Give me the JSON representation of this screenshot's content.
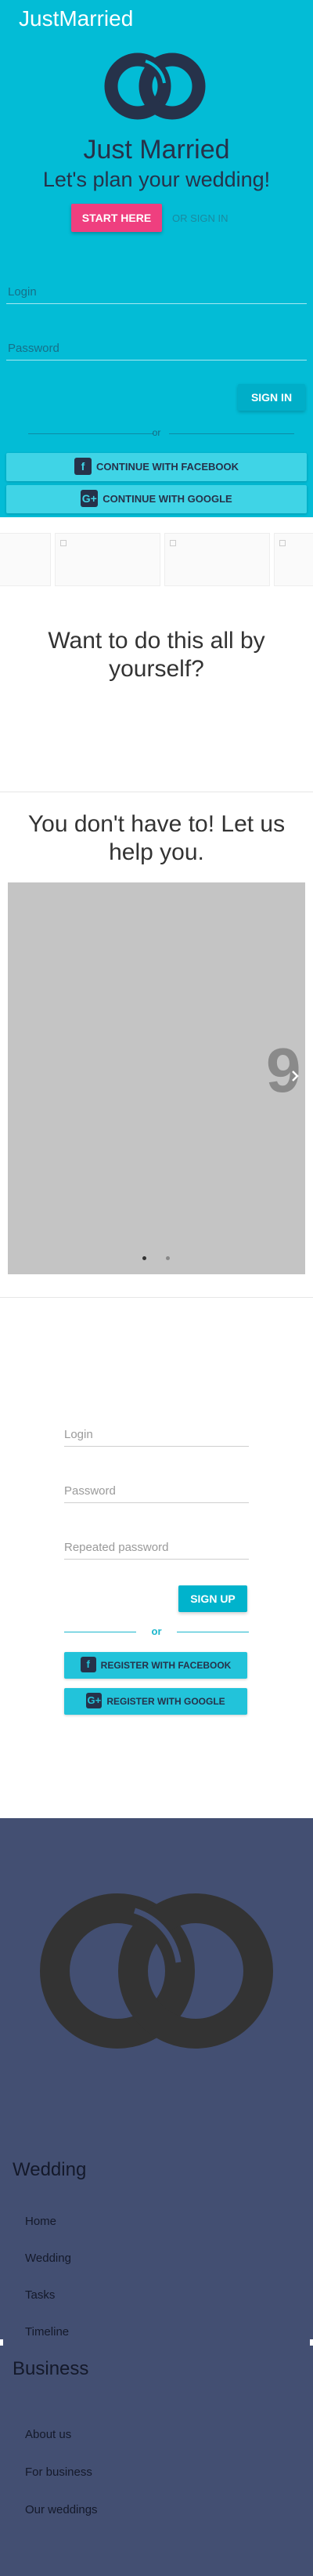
{
  "colors": {
    "hero_bg": "#03bcd6",
    "accent_pink": "#ef3f7f",
    "accent_cyan": "#00b3cc",
    "footer_bg": "#434f72"
  },
  "header": {
    "brand": "JustMarried"
  },
  "hero": {
    "title": "Just Married",
    "subtitle": "Let's plan your wedding!",
    "start_label": "START HERE",
    "signin_link": "OR SIGN IN",
    "login_placeholder": "Login",
    "password_placeholder": "Password",
    "signin_label": "SIGN IN",
    "or": "or",
    "facebook_label": "CONTINUE WITH FACEBOOK",
    "google_label": "CONTINUE WITH GOOGLE",
    "facebook_icon": "facebook-icon",
    "google_icon": "google-plus-icon"
  },
  "diy": {
    "title": "Want to do this all by yourself?"
  },
  "help": {
    "title": "You don't have to! Let us help you.",
    "slide_number": "9",
    "slides_total": 2,
    "active_slide": 1
  },
  "register": {
    "login_placeholder": "Login",
    "password_placeholder": "Password",
    "repeat_placeholder": "Repeated password",
    "signup_label": "SIGN UP",
    "or": "or",
    "facebook_label": "REGISTER WITH FACEBOOK",
    "google_label": "REGISTER WITH GOOGLE"
  },
  "footer": {
    "wedding_heading": "Wedding",
    "wedding_links": [
      "Home",
      "Wedding",
      "Tasks",
      "Timeline"
    ],
    "business_heading": "Business",
    "business_links": [
      "About us",
      "For business",
      "Our weddings"
    ]
  }
}
